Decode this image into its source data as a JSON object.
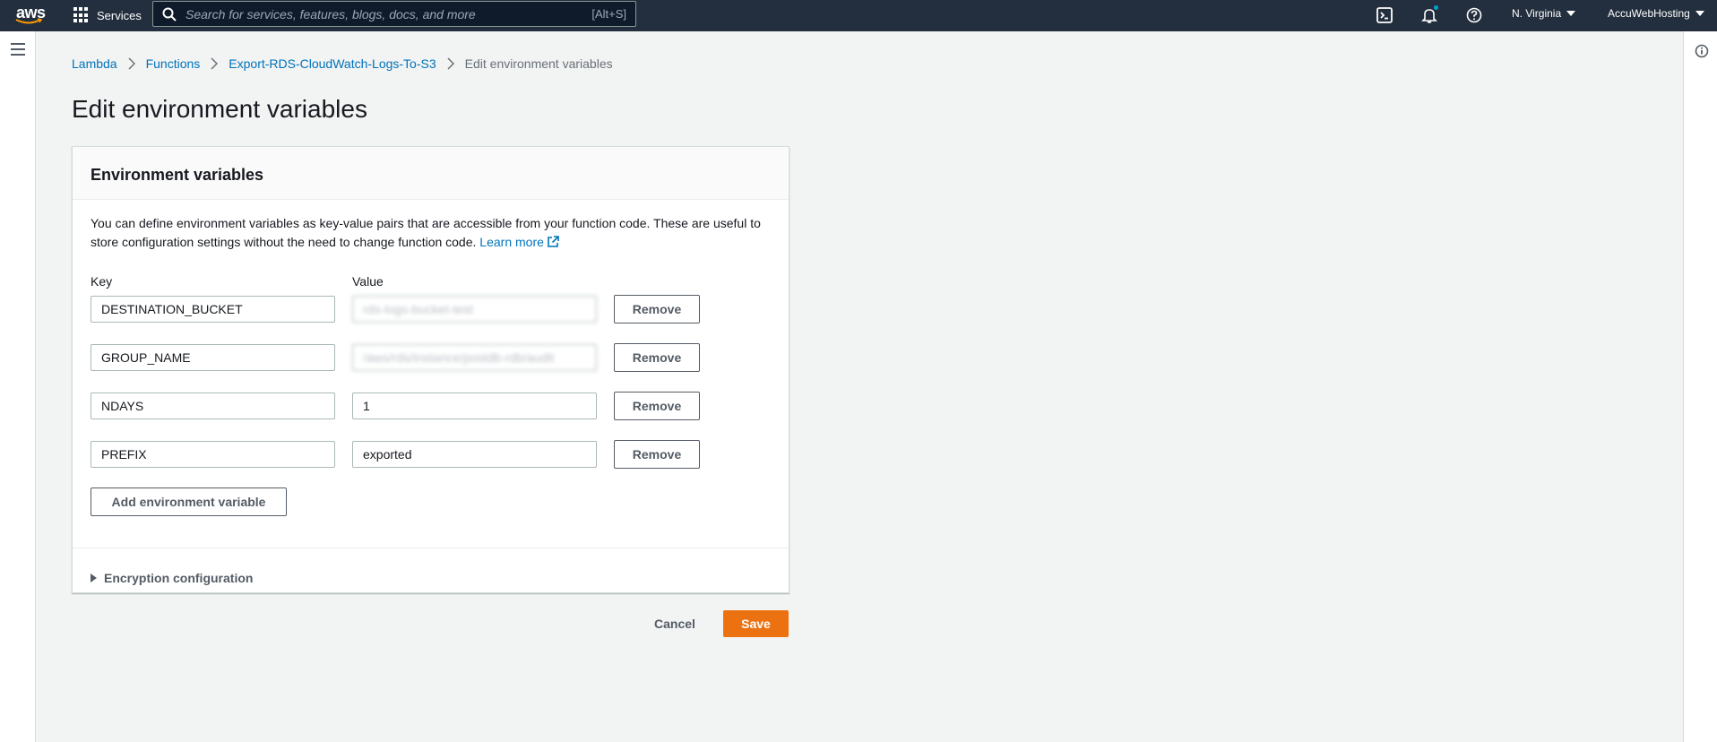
{
  "topnav": {
    "logo_text": "aws",
    "services_label": "Services",
    "search_placeholder": "Search for services, features, blogs, docs, and more",
    "search_shortcut": "[Alt+S]",
    "region": "N. Virginia",
    "account": "AccuWebHosting"
  },
  "breadcrumb": {
    "items": [
      "Lambda",
      "Functions",
      "Export-RDS-CloudWatch-Logs-To-S3"
    ],
    "current": "Edit environment variables"
  },
  "page": {
    "title": "Edit environment variables"
  },
  "panel": {
    "title": "Environment variables",
    "description": "You can define environment variables as key-value pairs that are accessible from your function code. These are useful to store configuration settings without the need to change function code.",
    "learn_more": "Learn more",
    "key_label": "Key",
    "value_label": "Value",
    "variables": [
      {
        "key": "DESTINATION_BUCKET",
        "value": "rds-logs-bucket-test"
      },
      {
        "key": "GROUP_NAME",
        "value": "/aws/rds/instance/postdb-rdb/audit"
      },
      {
        "key": "NDAYS",
        "value": "1"
      },
      {
        "key": "PREFIX",
        "value": "exported"
      }
    ],
    "remove_label": "Remove",
    "add_label": "Add environment variable",
    "encryption_label": "Encryption configuration"
  },
  "actions": {
    "cancel": "Cancel",
    "save": "Save"
  },
  "colors": {
    "nav": "#232f3e",
    "link": "#0073bb",
    "primary": "#ec7211"
  }
}
